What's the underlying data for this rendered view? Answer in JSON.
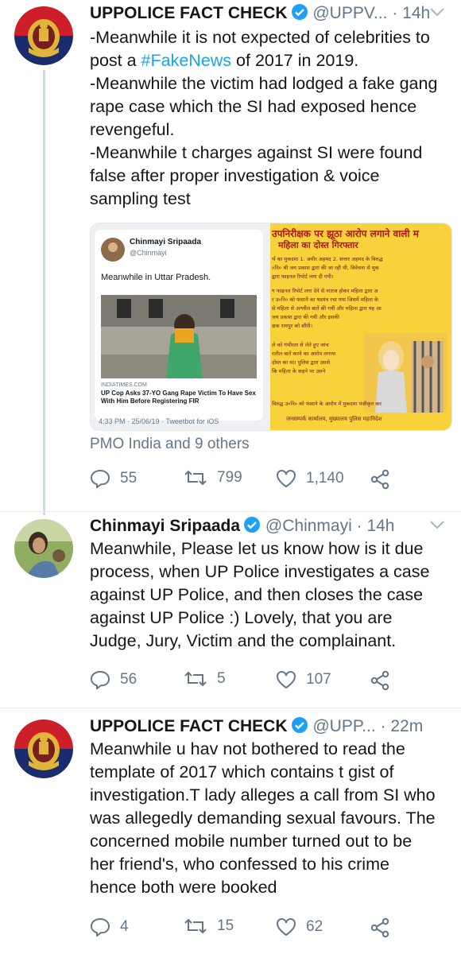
{
  "colors": {
    "accent": "#1da1f2",
    "muted": "#657786",
    "line": "#d3dbe2",
    "retweet": "#17bf63"
  },
  "tweets": [
    {
      "name": "UPPOLICE FACT CHECK",
      "handle": "@UPPV...",
      "dot": "·",
      "time": "14h",
      "lines": [
        "-Meanwhile it is not expected of celebrities to",
        "post a ",
        "#FakeNews",
        " of 2017 in 2019.",
        "-Meanwhile the victim had lodged a fake gang",
        "rape case which the SI had exposed hence",
        "revengeful.",
        "-Meanwhile t charges against SI were found",
        "false after proper investigation & voice",
        "sampling test"
      ],
      "replied": "PMO India and 9 others",
      "replies": "55",
      "retweets": "799",
      "likes": "1,140"
    },
    {
      "name": "Chinmayi Sripaada",
      "handle": "@Chinmayi",
      "dot": "·",
      "time": "14h",
      "lines": [
        "Meanwhile, Please let us know how is it due",
        "process, when UP Police investigates a case",
        "against UP Police, and then closes the case",
        "against UP Police :) Lovely, that you are",
        "Judge, Jury, Victim and the complainant."
      ],
      "replies": "56",
      "retweets": "5",
      "likes": "107"
    },
    {
      "name": "UPPOLICE FACT CHECK",
      "handle": "@UPP...",
      "dot": "·",
      "time": "22m",
      "lines": [
        "Meanwhile u hav not bothered to read the",
        "template of 2017 which contains t gist of",
        "investigation.T lady alleges a call from SI who",
        "was allegedly demanding sexual favours. The",
        "concerned mobile number turned out to be",
        "her friend's, who confessed to his crime",
        "hence both were booked"
      ],
      "replies": "4",
      "retweets": "15",
      "likes": "62"
    }
  ],
  "media": {
    "card": {
      "name": "Chinmayi Sripaada",
      "handle": "@Chinmayi",
      "text": "Meanwhile in Uttar Pradesh.",
      "source": "INDIATIMES.COM",
      "headline": "UP Cop Asks 37-YO Gang Rape Victim To Have Sex With Him Before Registering FIR",
      "footer": "4:33 PM · 25/06/19 · Tweetbot for iOS"
    },
    "poster": {
      "title1": "उपनिरीक्षक पर झूठा आरोप लगाने वाली म",
      "title2": "महिला का दोस्त गिरफ्तार",
      "lines": [
        "र्भ का मुकदमा 1. अमीर अहमद 2. सत्तार अहमद के विरुद्ध",
        "०नि० श्री जय प्रकाश द्वारा की जा रही थी, विवेचना से मुक",
        "द्वारा फाइनल रिपोर्ट लगा दी गयी।",
        "ग फाइनल रिपोर्ट लगा देने से नाराज होकर महिला द्वारा अ",
        "र उ०नि० को फंसाने का षडयंत्र रचा गया जिसमें महिला के",
        "से महिला से अश्लील बातें की गयीं और महिला द्वारा यह आ",
        "जय प्रकाश द्वारा की गयी और इसकी",
        "क्षक रामपुर को सौंपी।",
        "ले को गंभीरता से लेते हुए जांच",
        "रलील बातें करने का आरोप लगाया",
        "दोस्त का था। पुलिस द्वारा उससे",
        "कि महिला के कहने पर उसने",
        "विरुद्ध उ०नि० को फंसाने के आरोप में मुकदमा पंजीकृत कर",
        "जनसम्पर्क कार्यालय, मुख्यालय पुलिस महानिदेश"
      ]
    }
  }
}
